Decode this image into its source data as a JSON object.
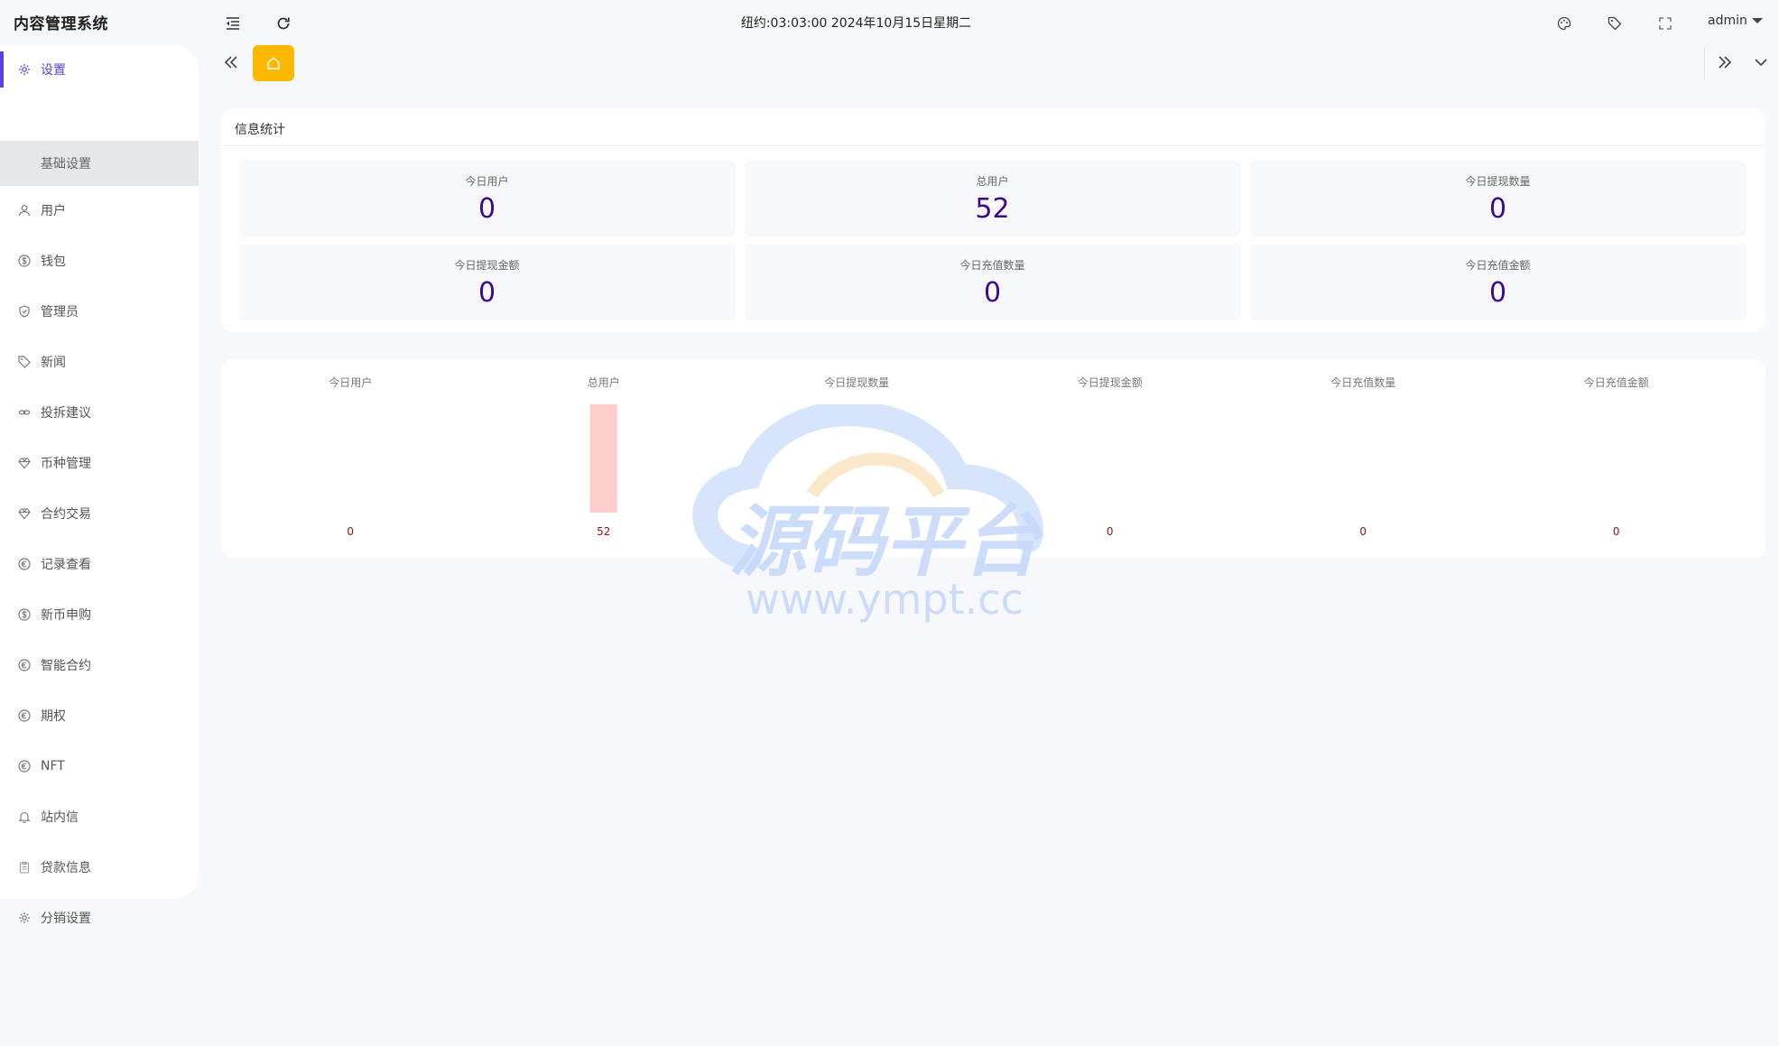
{
  "app": {
    "title": "内容管理系统"
  },
  "header": {
    "clock": "纽约:03:03:00 2024年10月15日星期二",
    "user": "admin"
  },
  "sidebar": {
    "items": [
      {
        "label": "设置",
        "icon": "gear-icon",
        "active": true
      },
      {
        "label": "基础设置",
        "icon": "",
        "sub": true
      },
      {
        "label": "用户",
        "icon": "user-icon"
      },
      {
        "label": "钱包",
        "icon": "dollar-icon"
      },
      {
        "label": "管理员",
        "icon": "shield-icon"
      },
      {
        "label": "新闻",
        "icon": "tag-icon"
      },
      {
        "label": "投拆建议",
        "icon": "link-icon"
      },
      {
        "label": "币种管理",
        "icon": "diamond-icon"
      },
      {
        "label": "合约交易",
        "icon": "diamond-icon"
      },
      {
        "label": "记录查看",
        "icon": "euro-icon"
      },
      {
        "label": "新币申购",
        "icon": "dollar-icon"
      },
      {
        "label": "智能合约",
        "icon": "euro-icon"
      },
      {
        "label": "期权",
        "icon": "euro-icon"
      },
      {
        "label": "NFT",
        "icon": "euro-icon"
      },
      {
        "label": "站内信",
        "icon": "bell-icon"
      },
      {
        "label": "贷款信息",
        "icon": "clipboard-icon"
      },
      {
        "label": "分销设置",
        "icon": "gear-icon"
      }
    ]
  },
  "stats": {
    "title": "信息统计",
    "items": [
      {
        "label": "今日用户",
        "value": "0"
      },
      {
        "label": "总用户",
        "value": "52"
      },
      {
        "label": "今日提现数量",
        "value": "0"
      },
      {
        "label": "今日提现金额",
        "value": "0"
      },
      {
        "label": "今日充值数量",
        "value": "0"
      },
      {
        "label": "今日充值金额",
        "value": "0"
      }
    ]
  },
  "chart_data": {
    "type": "bar",
    "categories": [
      "今日用户",
      "总用户",
      "今日提现数量",
      "今日提现金额",
      "今日充值数量",
      "今日充值金额"
    ],
    "values": [
      0,
      52,
      0,
      0,
      0,
      0
    ],
    "bar_color": "#ffcccc",
    "label_color": "#a10e0e",
    "title": "",
    "xlabel": "",
    "ylabel": "",
    "grid": false
  },
  "watermark": {
    "title": "源码平台",
    "url": "www.ympt.cc"
  },
  "colors": {
    "accent": "#5b3fe0",
    "home_tab": "#ffb800",
    "value": "#3b0a8f"
  }
}
